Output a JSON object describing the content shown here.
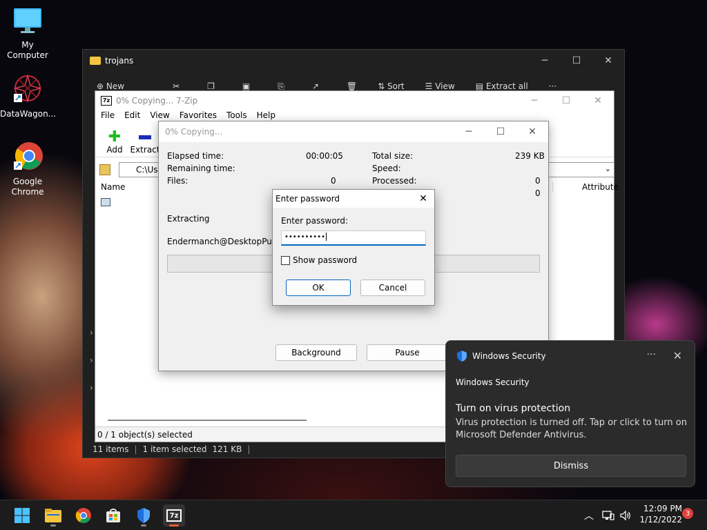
{
  "desktop": {
    "icons": [
      {
        "label": "My Computer"
      },
      {
        "label": "DataWagon..."
      },
      {
        "label": "Google Chrome"
      }
    ]
  },
  "explorer": {
    "title": "trojans",
    "toolbar": {
      "new": "New",
      "sort": "Sort",
      "view": "View",
      "extract_all": "Extract all"
    },
    "status": {
      "items": "11 items",
      "selected": "1 item selected",
      "size": "121 KB"
    }
  },
  "zip_main": {
    "title": "0% Copying... 7-Zip",
    "menu": [
      "File",
      "Edit",
      "View",
      "Favorites",
      "Tools",
      "Help"
    ],
    "toolbar": {
      "add": "Add",
      "extract": "Extract"
    },
    "address": "C:\\Use",
    "columns": {
      "name": "Name",
      "attributes": "Attribute"
    },
    "status": "0 / 1 object(s) selected"
  },
  "copying": {
    "title": "0% Copying...",
    "elapsed_label": "Elapsed time:",
    "elapsed_value": "00:00:05",
    "remaining_label": "Remaining time:",
    "files_label": "Files:",
    "files_value": "0",
    "total_label": "Total size:",
    "total_value": "239 KB",
    "speed_label": "Speed:",
    "processed_label": "Processed:",
    "processed_value": "0",
    "extra_value": "0",
    "action": "Extracting",
    "filename": "Endermanch@DesktopPuzzle.ex",
    "background_button": "Background",
    "pause_button": "Pause"
  },
  "password": {
    "title": "Enter password",
    "label": "Enter password:",
    "value": "••••••••••",
    "show_label": "Show password",
    "ok": "OK",
    "cancel": "Cancel"
  },
  "toast": {
    "app": "Windows Security",
    "more": "···",
    "header": "Windows Security",
    "title": "Turn on virus protection",
    "body": "Virus protection is turned off. Tap or click to turn on Microsoft Defender Antivirus.",
    "dismiss": "Dismiss"
  },
  "taskbar": {
    "time": "12:09 PM",
    "date": "1/12/2022",
    "notifications": "3"
  }
}
